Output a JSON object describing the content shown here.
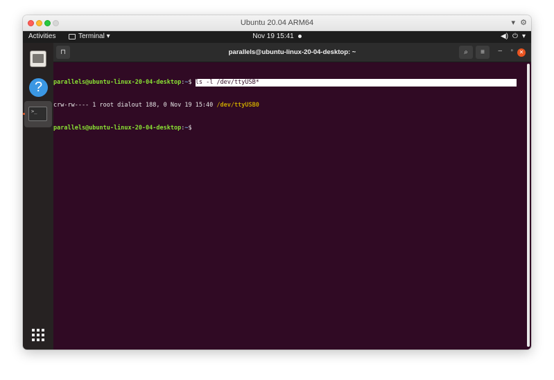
{
  "mac_window": {
    "title": "Ubuntu 20.04 ARM64",
    "right_icons": [
      "▾",
      "⚙"
    ]
  },
  "top_bar": {
    "activities": "Activities",
    "app_menu": "Terminal ▾",
    "clock": "Nov 19  15:41",
    "sys_icons": [
      "◀)",
      "⏻",
      "▾"
    ]
  },
  "dock": {
    "items": [
      {
        "name": "files-icon"
      },
      {
        "name": "help-icon",
        "glyph": "?"
      },
      {
        "name": "terminal-icon",
        "glyph": ">_"
      }
    ]
  },
  "terminal": {
    "title": "parallels@ubuntu-linux-20-04-desktop: ~",
    "newtab_glyph": "⊓",
    "search_glyph": "⌕",
    "menu_glyph": "≡",
    "minimize_glyph": "–",
    "maximize_glyph": "▫",
    "close_glyph": "✕",
    "lines": {
      "l1_user": "parallels@ubuntu-linux-20-04-desktop",
      "l1_sep": ":",
      "l1_path": "~",
      "l1_dollar": "$ ",
      "l1_cmd": "ls -l /dev/ttyUSB*",
      "l2_text": "crw-rw---- 1 root dialout 188, 0 Nov 19 15:40 ",
      "l2_dev": "/dev/ttyUSB0",
      "l3_user": "parallels@ubuntu-linux-20-04-desktop",
      "l3_sep": ":",
      "l3_path": "~",
      "l3_dollar": "$"
    }
  },
  "colors": {
    "terminal_bg": "#300a24",
    "prompt_user": "#8ae234",
    "prompt_path": "#729fcf",
    "device_highlight": "#c4a000",
    "accent": "#e95420"
  }
}
